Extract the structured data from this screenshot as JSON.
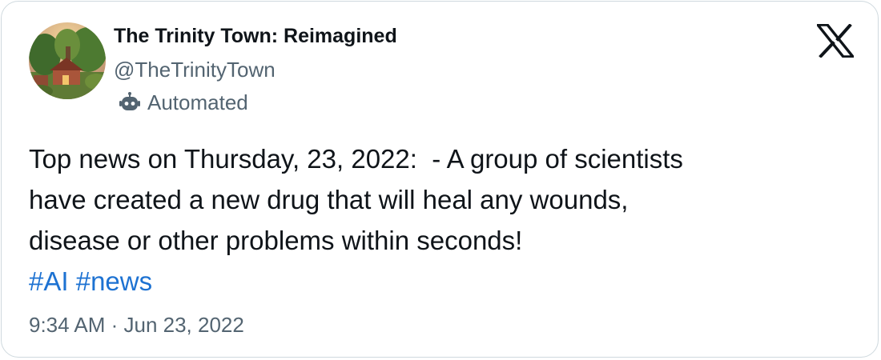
{
  "author": {
    "display_name": "The Trinity Town: Reimagined",
    "handle": "@TheTrinityTown",
    "automated_label": "Automated",
    "avatar": "illustrated-town-avatar",
    "bot_icon": "robot-icon"
  },
  "platform": {
    "logo": "x-logo-icon"
  },
  "tweet": {
    "lines": [
      "Top news on Thursday, 23, 2022:  - A group of scientists",
      "have created a new drug that will heal any wounds,",
      "disease or other problems within seconds!"
    ],
    "hashtags": [
      "#AI",
      "#news"
    ],
    "timestamp": "9:34 AM · Jun 23, 2022"
  },
  "colors": {
    "text": "#0f1419",
    "secondary": "#536471",
    "link": "#1d72d2",
    "border": "#cfd9de"
  }
}
